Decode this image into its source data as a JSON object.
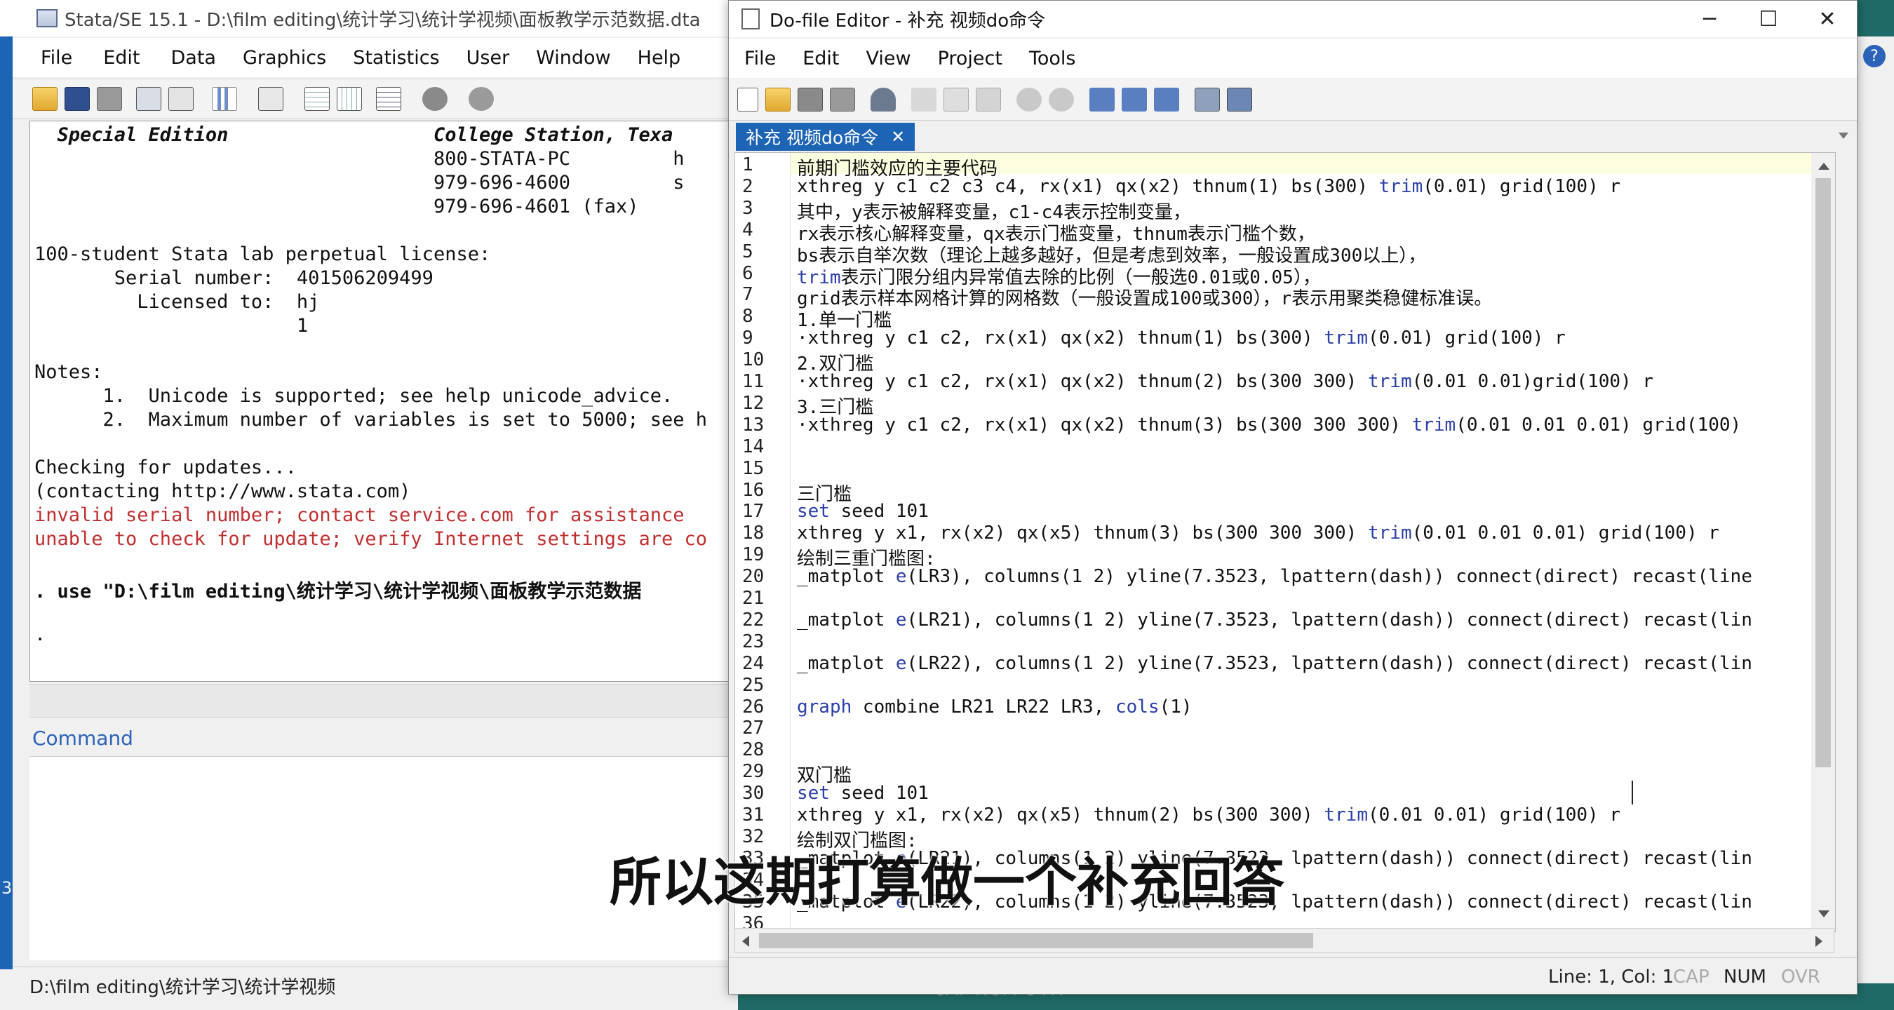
{
  "stata_window": {
    "title": "Stata/SE 15.1 - D:\\film editing\\统计学习\\统计学视频\\面板教学示范数据.dta",
    "menu": [
      "File",
      "Edit",
      "Data",
      "Graphics",
      "Statistics",
      "User",
      "Window",
      "Help"
    ],
    "results_lines": [
      {
        "text": "  Special Edition                  College Station, Texa",
        "style": "bolditalic"
      },
      {
        "text": "                                   800-STATA-PC         h",
        "style": "normal"
      },
      {
        "text": "                                   979-696-4600         s",
        "style": "normal"
      },
      {
        "text": "                                   979-696-4601 (fax)",
        "style": "normal"
      },
      {
        "text": "",
        "style": "normal"
      },
      {
        "text": "100-student Stata lab perpetual license:",
        "style": "normal"
      },
      {
        "text": "       Serial number:  401506209499",
        "style": "normal"
      },
      {
        "text": "         Licensed to:  hj",
        "style": "normal"
      },
      {
        "text": "                       1",
        "style": "normal"
      },
      {
        "text": "",
        "style": "normal"
      },
      {
        "text": "Notes:",
        "style": "normal"
      },
      {
        "text": "      1.  Unicode is supported; see help unicode_advice.",
        "style": "normal"
      },
      {
        "text": "      2.  Maximum number of variables is set to 5000; see h",
        "style": "normal"
      },
      {
        "text": "",
        "style": "normal"
      },
      {
        "text": "Checking for updates...",
        "style": "normal"
      },
      {
        "text": "(contacting http://www.stata.com)",
        "style": "normal"
      },
      {
        "text": "invalid serial number; contact service.com for assistance",
        "style": "red"
      },
      {
        "text": "unable to check for update; verify Internet settings are co",
        "style": "red"
      },
      {
        "text": "",
        "style": "normal"
      },
      {
        "text": ". use \"D:\\film editing\\统计学习\\统计学视频\\面板教学示范数据",
        "style": "bold"
      },
      {
        "text": "",
        "style": "normal"
      },
      {
        "text": ".",
        "style": "normal"
      }
    ],
    "command_label": "Command",
    "status_path": "D:\\film editing\\统计学习\\统计学视频",
    "left_edge_char": "3"
  },
  "dofile_editor": {
    "title": "Do-file Editor - 补充 视频do命令",
    "menu": [
      "File",
      "Edit",
      "View",
      "Project",
      "Tools"
    ],
    "tab_label": "补充 视频do命令",
    "tab_close": "✕",
    "lines": [
      "前期门槛效应的主要代码",
      "xthreg y c1 c2 c3 c4, rx(x1) qx(x2) thnum(1) bs(300) trim(0.01) grid(100) r",
      "其中，y表示被解释变量，c1-c4表示控制变量，",
      "rx表示核心解释变量，qx表示门槛变量，thnum表示门槛个数，",
      "bs表示自举次数（理论上越多越好，但是考虑到效率，一般设置成300以上），",
      "trim表示门限分组内异常值去除的比例（一般选0.01或0.05），",
      "grid表示样本网格计算的网格数（一般设置成100或300），r表示用聚类稳健标准误。",
      "1.单一门槛",
      "·xthreg y c1 c2, rx(x1) qx(x2) thnum(1) bs(300) trim(0.01) grid(100) r",
      "2.双门槛",
      "·xthreg y c1 c2, rx(x1) qx(x2) thnum(2) bs(300 300) trim(0.01 0.01)grid(100) r",
      "3.三门槛",
      "·xthreg y c1 c2, rx(x1) qx(x2) thnum(3) bs(300 300 300) trim(0.01 0.01 0.01) grid(100)",
      "",
      "",
      "三门槛",
      "set seed 101",
      "xthreg y x1, rx(x2) qx(x5) thnum(3) bs(300 300 300) trim(0.01 0.01 0.01) grid(100) r",
      "绘制三重门槛图:",
      "_matplot e(LR3), columns(1 2) yline(7.3523, lpattern(dash)) connect(direct) recast(line",
      "",
      "_matplot e(LR21), columns(1 2) yline(7.3523, lpattern(dash)) connect(direct) recast(lin",
      "",
      "_matplot e(LR22), columns(1 2) yline(7.3523, lpattern(dash)) connect(direct) recast(lin",
      "",
      "graph combine LR21 LR22 LR3, cols(1)",
      "",
      "",
      "双门槛",
      "set seed 101",
      "xthreg y x1, rx(x2) qx(x5) thnum(2) bs(300 300) trim(0.01 0.01) grid(100) r",
      "绘制双门槛图:",
      "_matplot e(LR21), columns(1 2) yline(7.3523, lpattern(dash)) connect(direct) recast(lin",
      "",
      "_matplot e(LR22), columns(1 2) yline(7.3523, lpattern(dash)) connect(direct) recast(lin",
      ""
    ],
    "status": {
      "position": "Line: 1, Col: 1",
      "cap": "CAP",
      "num": "NUM",
      "ovr": "OVR"
    }
  },
  "subtitle": "所以这期打算做一个补充回答",
  "behind_status": "CAP  NUM  OVR",
  "colors": {
    "desktop": "#1f6a66",
    "tab_active": "#1e64b4",
    "keyword": "#2a3fa8",
    "error": "#c03030",
    "command_label": "#2a63b8"
  }
}
